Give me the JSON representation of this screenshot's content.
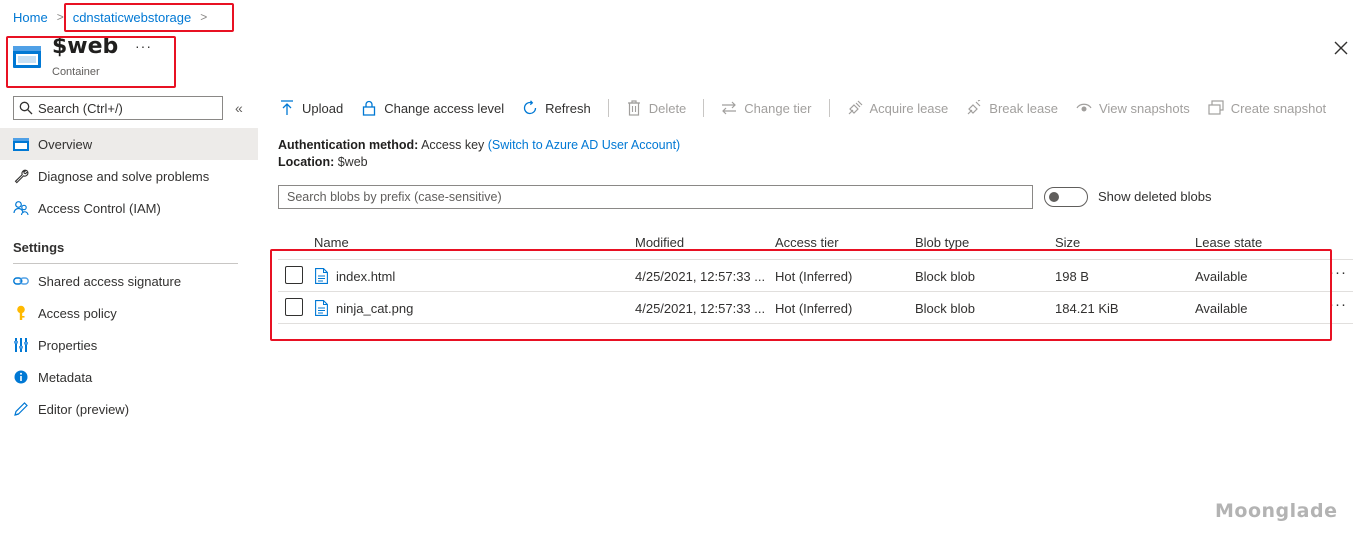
{
  "breadcrumb": {
    "home": "Home",
    "current": "cdnstaticwebstorage"
  },
  "header": {
    "title": "$web",
    "subtitle": "Container",
    "more": "···"
  },
  "sidebar": {
    "search_placeholder": "Search (Ctrl+/)",
    "collapse_glyph": "«",
    "items": [
      {
        "label": "Overview",
        "icon": "container-icon"
      },
      {
        "label": "Diagnose and solve problems",
        "icon": "wrench-icon"
      },
      {
        "label": "Access Control (IAM)",
        "icon": "people-icon"
      }
    ],
    "section_title": "Settings",
    "settings_items": [
      {
        "label": "Shared access signature",
        "icon": "link-icon"
      },
      {
        "label": "Access policy",
        "icon": "key-icon"
      },
      {
        "label": "Properties",
        "icon": "properties-icon"
      },
      {
        "label": "Metadata",
        "icon": "info-icon"
      },
      {
        "label": "Editor (preview)",
        "icon": "pencil-icon"
      }
    ]
  },
  "toolbar": {
    "upload": "Upload",
    "change_access_level": "Change access level",
    "refresh": "Refresh",
    "delete": "Delete",
    "change_tier": "Change tier",
    "acquire_lease": "Acquire lease",
    "break_lease": "Break lease",
    "view_snapshots": "View snapshots",
    "create_snapshot": "Create snapshot"
  },
  "info": {
    "auth_label": "Authentication method:",
    "auth_value": "Access key",
    "auth_link": "(Switch to Azure AD User Account)",
    "location_label": "Location:",
    "location_value": "$web"
  },
  "blob_search": {
    "placeholder": "Search blobs by prefix (case-sensitive)"
  },
  "show_deleted": {
    "label": "Show deleted blobs",
    "on": false
  },
  "table": {
    "columns": [
      "Name",
      "Modified",
      "Access tier",
      "Blob type",
      "Size",
      "Lease state"
    ],
    "rows": [
      {
        "name": "index.html",
        "modified": "4/25/2021, 12:57:33 ...",
        "tier": "Hot (Inferred)",
        "type": "Block blob",
        "size": "198 B",
        "lease": "Available"
      },
      {
        "name": "ninja_cat.png",
        "modified": "4/25/2021, 12:57:33 ...",
        "tier": "Hot (Inferred)",
        "type": "Block blob",
        "size": "184.21 KiB",
        "lease": "Available"
      }
    ],
    "row_more": "···"
  },
  "watermark": "Moonglade",
  "colors": {
    "accent": "#0078d4",
    "highlight": "#e81123",
    "active_bg": "#edebe9"
  }
}
